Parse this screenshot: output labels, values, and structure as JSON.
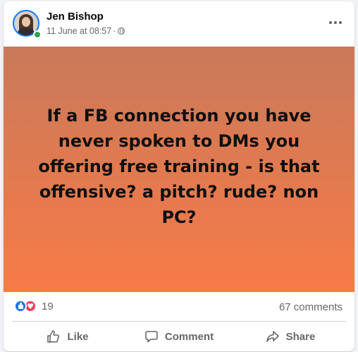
{
  "post": {
    "author": "Jen Bishop",
    "timestamp": "11 June at 08:57",
    "separator": "·",
    "audience_icon": "globe-icon",
    "more_icon": "more-horizontal-icon",
    "text": "If a FB connection you have never spoken to DMs you offering free training - is that offensive? a pitch? rude? non PC?",
    "background": {
      "top": "#c87a5a",
      "bottom": "#f77b48"
    }
  },
  "engagement": {
    "reaction_icons": [
      "like-reaction-icon",
      "love-reaction-icon"
    ],
    "reaction_count": "19",
    "comments": "67 comments"
  },
  "actions": {
    "like": "Like",
    "comment": "Comment",
    "share": "Share"
  },
  "colors": {
    "like_blue": "#1b74e4",
    "love_red": "#f33e58",
    "online_green": "#31a24c",
    "secondary_text": "#65676b"
  }
}
